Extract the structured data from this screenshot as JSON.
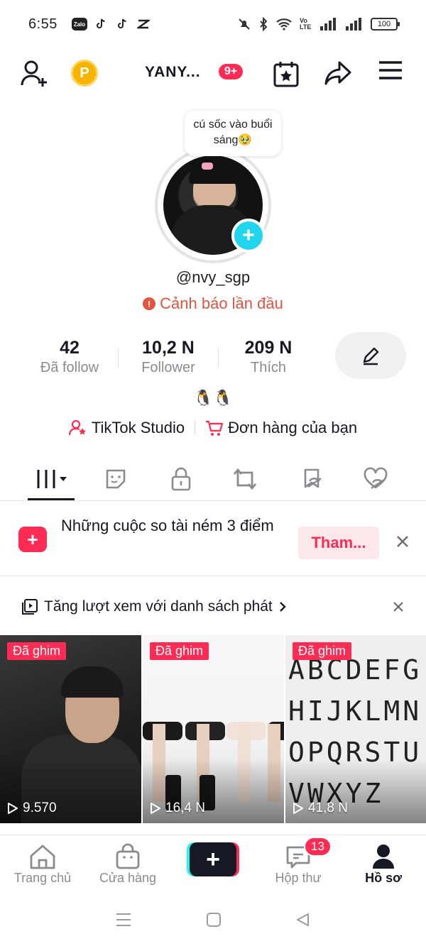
{
  "status": {
    "time": "6:55",
    "apps": [
      "Zalo",
      "tiktok-icon",
      "tiktok-icon",
      "capcut-icon"
    ],
    "network": "Vo LTE",
    "battery": "100"
  },
  "top_bar": {
    "username": "YANY...",
    "notif_count": "9+",
    "coin_label": "P"
  },
  "profile": {
    "bubble_text": "cú sốc vào buổi sáng🥹",
    "handle": "@nvy_sgp",
    "warning": "Cảnh báo lần đầu",
    "emoji_bio": "🐧🐧"
  },
  "stats": [
    {
      "value": "42",
      "label": "Đã follow"
    },
    {
      "value": "10,2 N",
      "label": "Follower"
    },
    {
      "value": "209 N",
      "label": "Thích"
    }
  ],
  "links": {
    "studio": "TikTok Studio",
    "orders": "Đơn hàng của bạn"
  },
  "tabs": [
    "grid-icon",
    "sticker-icon",
    "lock-icon",
    "repost-icon",
    "favorites-icon",
    "liked-icon"
  ],
  "banner": {
    "text": "Những cuộc so tài ném 3 điểm",
    "button": "Tham..."
  },
  "playlist": {
    "text": "Tăng lượt xem với danh sách phát"
  },
  "videos": [
    {
      "pinned": "Đã ghim",
      "views": "9.570"
    },
    {
      "pinned": "Đã ghim",
      "views": "16,4 N"
    },
    {
      "pinned": "Đã ghim",
      "views": "41,8 N"
    }
  ],
  "alphabet_text": "ABCDEFGHIJKLMNOPQRSTUVWXYZ",
  "bottom_nav": {
    "home": "Trang chủ",
    "shop": "Cửa hàng",
    "inbox": "Hộp thư",
    "inbox_badge": "13",
    "profile": "Hồ sơ"
  },
  "colors": {
    "accent": "#fe2c55",
    "cyan": "#20d5ec",
    "warning": "#e5533f",
    "muted": "#8a8b91"
  }
}
